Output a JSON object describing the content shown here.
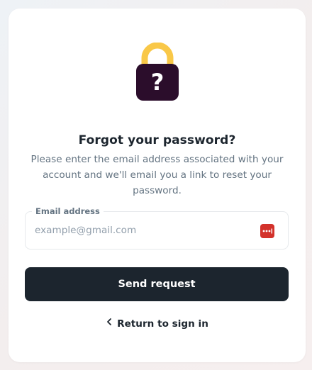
{
  "illustration": {
    "icon": "lock-question-icon",
    "shackle_color": "#F9C848",
    "body_color": "#2B0D2B",
    "symbol": "?"
  },
  "header": {
    "title": "Forgot your password?",
    "subtitle": "Please enter the email address associated with your account and we'll email you a link to reset your password."
  },
  "form": {
    "email_label": "Email address",
    "email_value": "",
    "email_placeholder": "example@gmail.com",
    "password_manager_icon": "password-manager-icon",
    "password_manager_color": "#D3322B",
    "submit_label": "Send request"
  },
  "footer": {
    "return_label": "Return to sign in",
    "return_icon": "chevron-left-icon"
  },
  "colors": {
    "primary_text": "#1C252E",
    "secondary_text": "#637381",
    "button_bg": "#1C252E",
    "button_text": "#FFFFFF"
  }
}
